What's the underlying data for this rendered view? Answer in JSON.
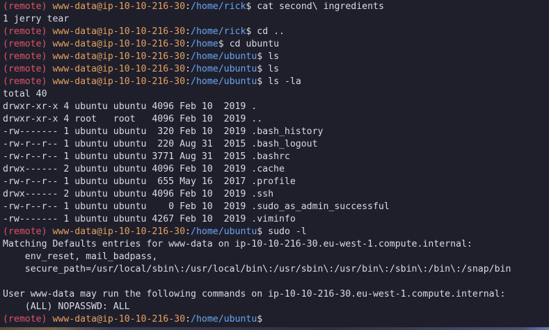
{
  "prompt": {
    "remote": "(remote)",
    "user_host": "www-data@ip-10-10-216-30",
    "colon": ":",
    "dollar": "$"
  },
  "lines": [
    {
      "kind": "prompt",
      "path": "/home/rick",
      "cmd": " cat second\\ ingredients"
    },
    {
      "kind": "output",
      "text": "1 jerry tear"
    },
    {
      "kind": "prompt",
      "path": "/home/rick",
      "cmd": " cd .."
    },
    {
      "kind": "prompt",
      "path": "/home",
      "cmd": " cd ubuntu"
    },
    {
      "kind": "prompt",
      "path": "/home/ubuntu",
      "cmd": " ls"
    },
    {
      "kind": "prompt",
      "path": "/home/ubuntu",
      "cmd": " ls"
    },
    {
      "kind": "prompt",
      "path": "/home/ubuntu",
      "cmd": " ls -la"
    },
    {
      "kind": "output",
      "text": "total 40"
    },
    {
      "kind": "output",
      "text": "drwxr-xr-x 4 ubuntu ubuntu 4096 Feb 10  2019 ."
    },
    {
      "kind": "output",
      "text": "drwxr-xr-x 4 root   root   4096 Feb 10  2019 .."
    },
    {
      "kind": "output",
      "text": "-rw------- 1 ubuntu ubuntu  320 Feb 10  2019 .bash_history"
    },
    {
      "kind": "output",
      "text": "-rw-r--r-- 1 ubuntu ubuntu  220 Aug 31  2015 .bash_logout"
    },
    {
      "kind": "output",
      "text": "-rw-r--r-- 1 ubuntu ubuntu 3771 Aug 31  2015 .bashrc"
    },
    {
      "kind": "output",
      "text": "drwx------ 2 ubuntu ubuntu 4096 Feb 10  2019 .cache"
    },
    {
      "kind": "output",
      "text": "-rw-r--r-- 1 ubuntu ubuntu  655 May 16  2017 .profile"
    },
    {
      "kind": "output",
      "text": "drwx------ 2 ubuntu ubuntu 4096 Feb 10  2019 .ssh"
    },
    {
      "kind": "output",
      "text": "-rw-r--r-- 1 ubuntu ubuntu    0 Feb 10  2019 .sudo_as_admin_successful"
    },
    {
      "kind": "output",
      "text": "-rw------- 1 ubuntu ubuntu 4267 Feb 10  2019 .viminfo"
    },
    {
      "kind": "prompt",
      "path": "/home/ubuntu",
      "cmd": " sudo -l"
    },
    {
      "kind": "output",
      "text": "Matching Defaults entries for www-data on ip-10-10-216-30.eu-west-1.compute.internal:"
    },
    {
      "kind": "output",
      "text": "    env_reset, mail_badpass,"
    },
    {
      "kind": "output",
      "text": "    secure_path=/usr/local/sbin\\:/usr/local/bin\\:/usr/sbin\\:/usr/bin\\:/sbin\\:/bin\\:/snap/bin"
    },
    {
      "kind": "output",
      "text": ""
    },
    {
      "kind": "output",
      "text": "User www-data may run the following commands on ip-10-10-216-30.eu-west-1.compute.internal:"
    },
    {
      "kind": "output",
      "text": "    (ALL) NOPASSWD: ALL"
    },
    {
      "kind": "prompt",
      "path": "/home/ubuntu",
      "cmd": ""
    }
  ],
  "colors": {
    "background": "#1f1f2c",
    "remote": "#e25563",
    "user_host": "#e6a15e",
    "path": "#6aa6f0",
    "text": "#d9dbe5"
  }
}
